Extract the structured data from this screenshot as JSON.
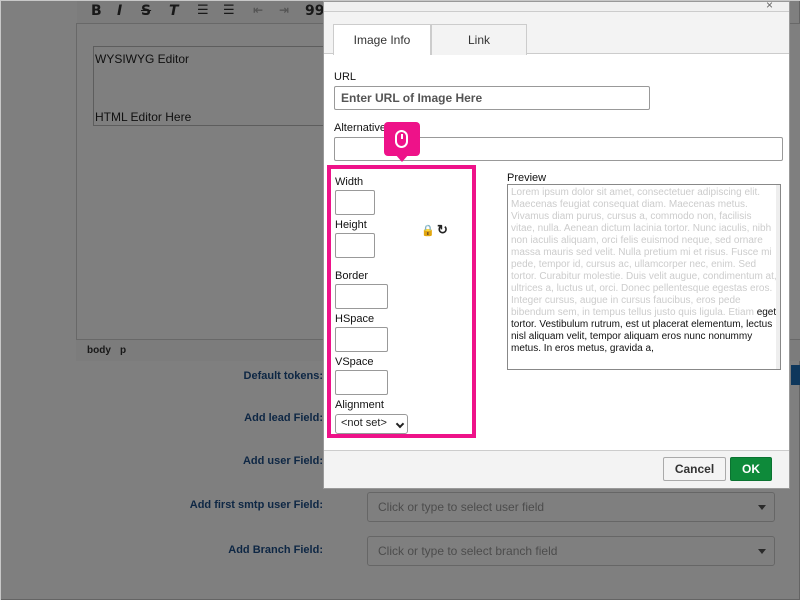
{
  "editor": {
    "content_line1": "WYSIWYG Editor",
    "content_line2": "HTML Editor Here",
    "path": [
      "body",
      "p"
    ],
    "toolbar": {
      "bold": "B",
      "italic": "I",
      "strike": "S",
      "clear": "T",
      "quote": "99"
    }
  },
  "form": {
    "default_tokens_label": "Default tokens:",
    "lead_field_label": "Add lead Field:",
    "user_field_label": "Add user Field:",
    "smtp_field_label": "Add first smtp user Field:",
    "smtp_field_placeholder": "Click or type to select user field",
    "branch_field_label": "Add Branch Field:",
    "branch_field_placeholder": "Click or type to select branch field"
  },
  "dialog": {
    "tabs": [
      {
        "label": "Image Info",
        "active": true
      },
      {
        "label": "Link",
        "active": false
      }
    ],
    "url_label": "URL",
    "url_placeholder": "Enter URL of Image Here",
    "alt_label": "Alternative",
    "width_label": "Width",
    "height_label": "Height",
    "border_label": "Border",
    "hspace_label": "HSpace",
    "vspace_label": "VSpace",
    "alignment_label": "Alignment",
    "alignment_value": "<not set>",
    "preview_label": "Preview",
    "preview_gray": "Lorem ipsum dolor sit amet, consectetuer adipiscing elit. Maecenas feugiat consequat diam. Maecenas metus. Vivamus diam purus, cursus a, commodo non, facilisis vitae, nulla. Aenean dictum lacinia tortor. Nunc iaculis, nibh non iaculis aliquam, orci felis euismod neque, sed ornare massa mauris sed velit. Nulla pretium mi et risus. Fusce mi pede, tempor id, cursus ac, ullamcorper nec, enim. Sed tortor. Curabitur molestie. Duis velit augue, condimentum at, ultrices a, luctus ut, orci. Donec pellentesque egestas eros. Integer cursus, augue in cursus faucibus, eros pede bibendum sem, in tempus tellus justo quis ligula. Etiam",
    "preview_dark": "eget tortor. Vestibulum rutrum, est ut placerat elementum, lectus nisl aliquam velit, tempor aliquam eros nunc nonummy metus. In eros metus, gravida a,",
    "cancel_label": "Cancel",
    "ok_label": "OK"
  },
  "colors": {
    "highlight": "#ee1289",
    "ok": "#0e8a3a",
    "label_blue": "#1d4e89"
  }
}
